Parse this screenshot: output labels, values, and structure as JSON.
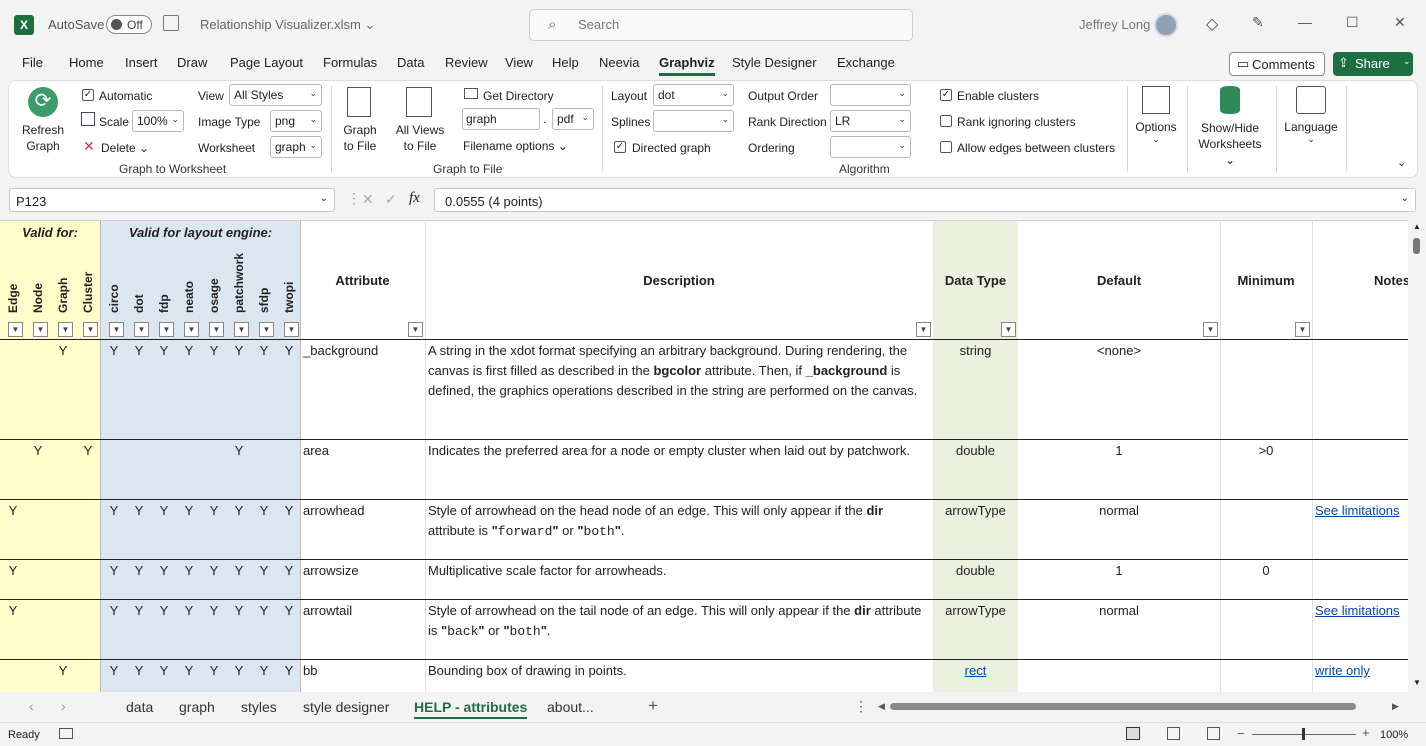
{
  "window": {
    "autosave_label": "AutoSave",
    "autosave_state": "Off",
    "filename": "Relationship Visualizer.xlsm",
    "search_placeholder": "Search",
    "user": "Jeffrey Long"
  },
  "menu": {
    "tabs": [
      "File",
      "Home",
      "Insert",
      "Draw",
      "Page Layout",
      "Formulas",
      "Data",
      "Review",
      "View",
      "Help",
      "Neevia",
      "Graphviz",
      "Style Designer",
      "Exchange"
    ],
    "active": "Graphviz",
    "comments": "Comments",
    "share": "Share"
  },
  "ribbon": {
    "refresh": "Refresh Graph",
    "refresh1": "Refresh",
    "refresh2": "Graph",
    "automatic": "Automatic",
    "scale_label": "Scale",
    "scale_value": "100%",
    "delete": "Delete",
    "view_label": "View",
    "view_value": "All Styles",
    "image_type_label": "Image Type",
    "image_type_value": "png",
    "worksheet_label": "Worksheet",
    "worksheet_value": "graph",
    "group1": "Graph to Worksheet",
    "graph_to_file1": "Graph",
    "graph_to_file2": "to File",
    "all_views1": "All Views",
    "all_views2": "to File",
    "get_directory": "Get Directory",
    "filename_value": "graph",
    "ext_value": "pdf",
    "filename_options": "Filename options",
    "group2": "Graph to File",
    "layout_label": "Layout",
    "layout_value": "dot",
    "splines_label": "Splines",
    "splines_value": "",
    "directed": "Directed graph",
    "output_order_label": "Output Order",
    "output_order_value": "",
    "rank_dir_label": "Rank Direction",
    "rank_dir_value": "LR",
    "ordering_label": "Ordering",
    "ordering_value": "",
    "group3": "Algorithm",
    "enable_clusters": "Enable clusters",
    "rank_ignoring": "Rank ignoring clusters",
    "allow_edges": "Allow edges between clusters",
    "options": "Options",
    "show_hide1": "Show/Hide",
    "show_hide2": "Worksheets",
    "language": "Language"
  },
  "formula": {
    "cell_ref": "P123",
    "value": "0.0555 (4 points)"
  },
  "sheet": {
    "valid_for": "Valid for:",
    "valid_engine": "Valid for layout engine:",
    "vcols": [
      "Edge",
      "Node",
      "Graph",
      "Cluster",
      "circo",
      "dot",
      "fdp",
      "neato",
      "osage",
      "patchwork",
      "sfdp",
      "twopi"
    ],
    "headers": {
      "attribute": "Attribute",
      "description": "Description",
      "datatype": "Data Type",
      "default": "Default",
      "minimum": "Minimum",
      "notes": "Notes"
    },
    "rows": [
      {
        "flags": [
          "",
          "",
          "Y",
          "",
          "Y",
          "Y",
          "Y",
          "Y",
          "Y",
          "Y",
          "Y",
          "Y"
        ],
        "attribute": "_background",
        "desc_html": "A string in the xdot format specifying an arbitrary background. During rendering, the canvas is first filled as described in the <b>bgcolor</b> attribute. Then, if <b>_background</b> is defined, the graphics operations described in the string are performed on the canvas.",
        "datatype": "string",
        "default": "<none>",
        "minimum": "",
        "notes": ""
      },
      {
        "flags": [
          "",
          "Y",
          "",
          "Y",
          "",
          "",
          "",
          "",
          "",
          "Y",
          "",
          ""
        ],
        "attribute": "area",
        "desc_html": "Indicates the preferred area for a node or empty cluster when laid out by patchwork.",
        "datatype": "double",
        "default": "1",
        "minimum": ">0",
        "notes": ""
      },
      {
        "flags": [
          "Y",
          "",
          "",
          "",
          "Y",
          "Y",
          "Y",
          "Y",
          "Y",
          "Y",
          "Y",
          "Y"
        ],
        "attribute": "arrowhead",
        "desc_html": "Style of arrowhead on the head node of an edge. This will only appear if the <b>dir</b> attribute is <b>\"</b><span style='font-family:Liberation Mono,monospace'>forward</span><b>\"</b> or <b>\"</b><span style='font-family:Liberation Mono,monospace'>both</span><b>\"</b>.",
        "datatype": "arrowType",
        "default": "normal",
        "minimum": "",
        "notes": "See limitations"
      },
      {
        "flags": [
          "Y",
          "",
          "",
          "",
          "Y",
          "Y",
          "Y",
          "Y",
          "Y",
          "Y",
          "Y",
          "Y"
        ],
        "attribute": "arrowsize",
        "desc_html": "Multiplicative scale factor for arrowheads.",
        "datatype": "double",
        "default": "1",
        "minimum": "0",
        "notes": ""
      },
      {
        "flags": [
          "Y",
          "",
          "",
          "",
          "Y",
          "Y",
          "Y",
          "Y",
          "Y",
          "Y",
          "Y",
          "Y"
        ],
        "attribute": "arrowtail",
        "desc_html": "Style of arrowhead on the tail node of an edge. This will only appear if the <b>dir</b> attribute is <b>\"</b><span style='font-family:Liberation Mono,monospace'>back</span><b>\"</b> or <b>\"</b><span style='font-family:Liberation Mono,monospace'>both</span><b>\"</b>.",
        "datatype": "arrowType",
        "default": "normal",
        "minimum": "",
        "notes": "See limitations"
      },
      {
        "flags": [
          "",
          "",
          "Y",
          "",
          "Y",
          "Y",
          "Y",
          "Y",
          "Y",
          "Y",
          "Y",
          "Y"
        ],
        "attribute": "bb",
        "desc_html": "Bounding box of drawing in points.",
        "datatype": "rect",
        "default": "",
        "minimum": "",
        "notes": "write only"
      }
    ]
  },
  "sheet_tabs": [
    "data",
    "graph",
    "styles",
    "style designer",
    "HELP - attributes",
    "about..."
  ],
  "active_sheet": "HELP - attributes",
  "status": {
    "ready": "Ready",
    "zoom": "100%"
  },
  "colors": {
    "excel_green": "#1d6f42",
    "valid_for_bg": "#ffffcc",
    "engine_bg": "#dce6f1",
    "datatype_bg": "#ebf1de"
  }
}
